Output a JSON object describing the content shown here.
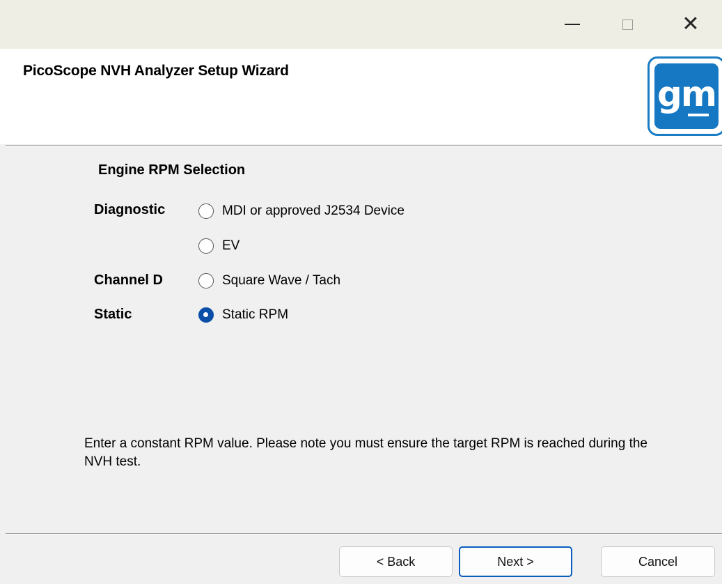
{
  "window": {
    "icons": {
      "minimize": "minimize-icon",
      "maximize": "maximize-icon",
      "close": "close-icon"
    }
  },
  "header": {
    "title": "PicoScope NVH Analyzer Setup Wizard",
    "logo_text": "gm",
    "logo_color": "#1678c2"
  },
  "main": {
    "section_title": "Engine RPM Selection",
    "groups": [
      {
        "label": "Diagnostic",
        "options": [
          {
            "label": "MDI or approved J2534 Device",
            "checked": false
          },
          {
            "label": "EV",
            "checked": false
          }
        ]
      },
      {
        "label": "Channel D",
        "options": [
          {
            "label": "Square Wave / Tach",
            "checked": false
          }
        ]
      },
      {
        "label": "Static",
        "options": [
          {
            "label": "Static RPM",
            "checked": true
          }
        ]
      }
    ],
    "note": "Enter a constant RPM value. Please note you must ensure the target RPM is reached during the NVH test."
  },
  "footer": {
    "back_label": "< Back",
    "next_label": "Next >",
    "cancel_label": "Cancel",
    "accent_color": "#0b5cbf"
  }
}
